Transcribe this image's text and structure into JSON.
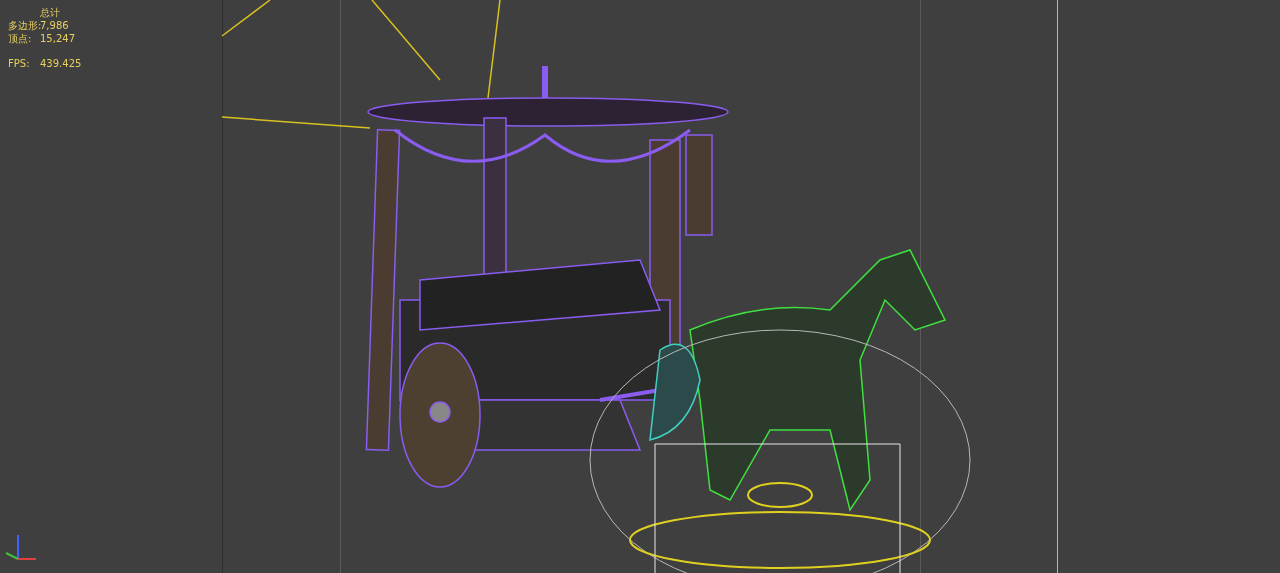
{
  "viewport_stats": {
    "title": "总计",
    "rows": [
      {
        "label": "多边形:",
        "value": "7,986"
      },
      {
        "label": "顶点:",
        "value": "15,247"
      }
    ],
    "fps": {
      "label": "FPS:",
      "value": "439.425"
    }
  }
}
